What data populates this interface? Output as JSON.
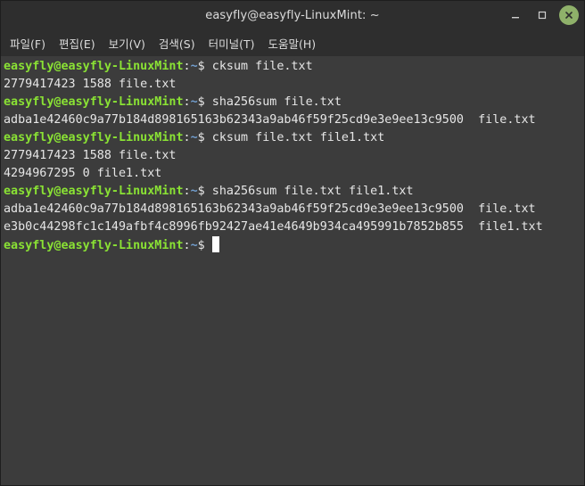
{
  "window": {
    "title": "easyfly@easyfly-LinuxMint: ~"
  },
  "menu": {
    "items": [
      "파일(F)",
      "편집(E)",
      "보기(V)",
      "검색(S)",
      "터미널(T)",
      "도움말(H)"
    ]
  },
  "prompt": {
    "user_host": "easyfly@easyfly-LinuxMint",
    "separator": ":",
    "path": "~",
    "symbol": "$ "
  },
  "terminal": {
    "lines": [
      {
        "type": "prompt",
        "command": "cksum file.txt"
      },
      {
        "type": "output",
        "text": "2779417423 1588 file.txt"
      },
      {
        "type": "prompt",
        "command": "sha256sum file.txt"
      },
      {
        "type": "output",
        "text": "adba1e42460c9a77b184d898165163b62343a9ab46f59f25cd9e3e9ee13c9500  file.txt"
      },
      {
        "type": "prompt",
        "command": "cksum file.txt file1.txt"
      },
      {
        "type": "output",
        "text": "2779417423 1588 file.txt"
      },
      {
        "type": "output",
        "text": "4294967295 0 file1.txt"
      },
      {
        "type": "prompt",
        "command": "sha256sum file.txt file1.txt"
      },
      {
        "type": "output",
        "text": "adba1e42460c9a77b184d898165163b62343a9ab46f59f25cd9e3e9ee13c9500  file.txt"
      },
      {
        "type": "output",
        "text": "e3b0c44298fc1c149afbf4c8996fb92427ae41e4649b934ca495991b7852b855  file1.txt"
      },
      {
        "type": "prompt",
        "command": "",
        "cursor": true
      }
    ]
  },
  "icons": {
    "minimize": "minimize-icon",
    "maximize": "maximize-icon",
    "close": "close-icon"
  },
  "colors": {
    "prompt_user": "#8ae234",
    "prompt_path": "#729fcf",
    "close_button": "#8fb16a",
    "terminal_bg": "#3c3c3c",
    "titlebar_bg": "#2e2e2e"
  }
}
